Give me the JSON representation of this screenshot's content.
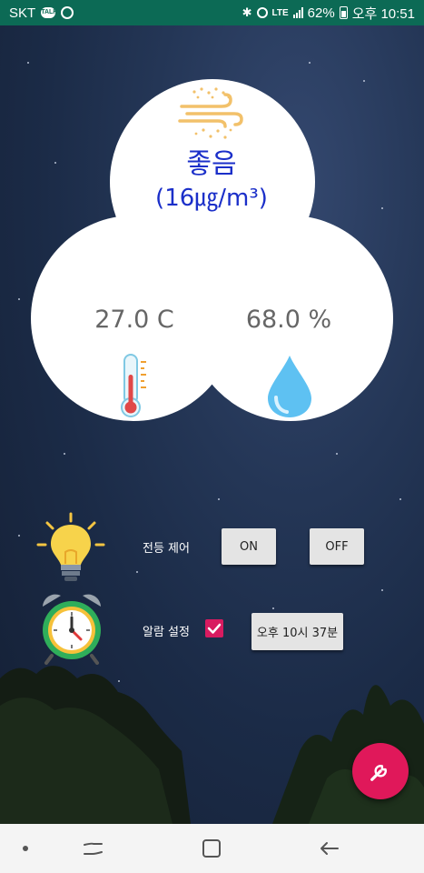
{
  "status_bar": {
    "carrier": "SKT",
    "network": "LTE",
    "battery": "62%",
    "time": "오후 10:51"
  },
  "air_quality": {
    "status": "좋음",
    "value": "(16㎍/m³)",
    "icon": "wind-dust-icon"
  },
  "temperature": {
    "value": "27.0 C",
    "icon": "thermometer-icon"
  },
  "humidity": {
    "value": "68.0 %",
    "icon": "water-drop-icon"
  },
  "light_control": {
    "label": "전등 제어",
    "on_label": "ON",
    "off_label": "OFF",
    "icon": "light-bulb-icon"
  },
  "alarm": {
    "label": "알람 설정",
    "checked": true,
    "time_button": "오후 10시 37분",
    "icon": "alarm-clock-icon"
  },
  "fab": {
    "icon": "wrench-icon"
  },
  "nav_bar": {
    "icons": [
      "recent-apps-icon",
      "home-icon",
      "back-icon"
    ]
  },
  "colors": {
    "status_bar": "#0c6a55",
    "accent": "#e0185a",
    "air_quality_text": "#1b2fc9",
    "value_text": "#666666"
  }
}
